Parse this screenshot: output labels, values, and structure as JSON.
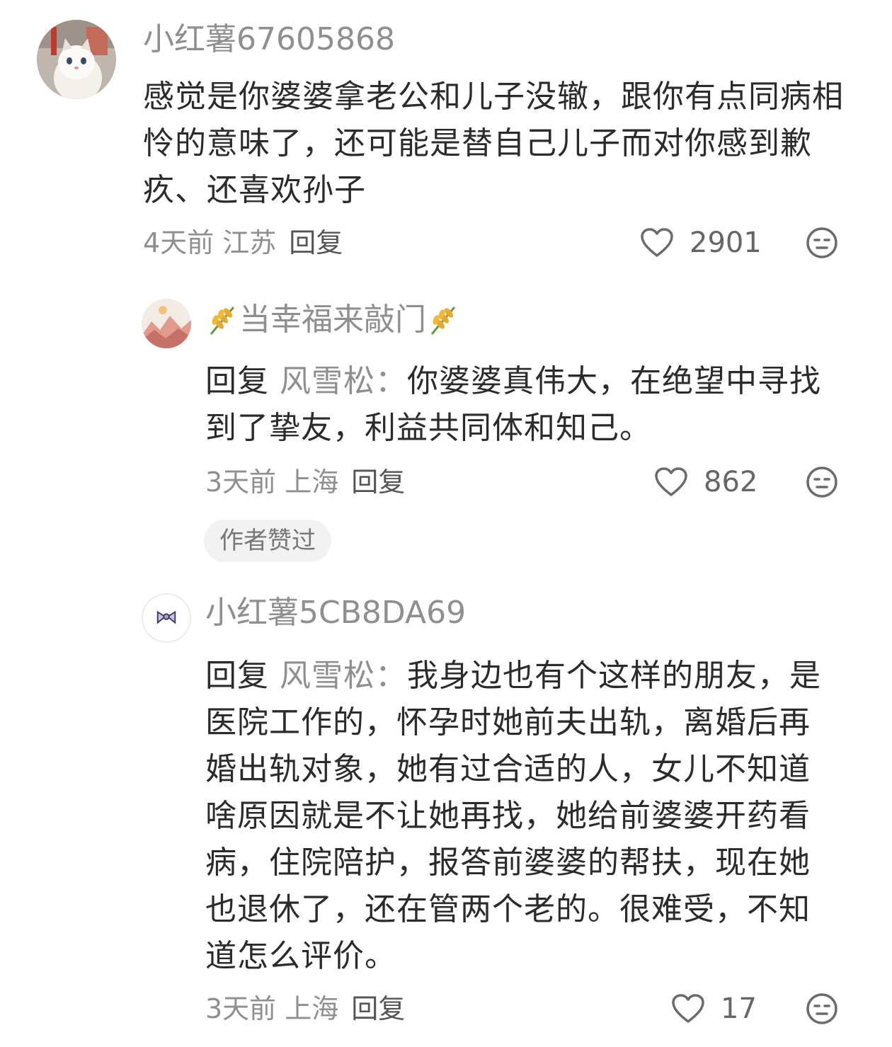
{
  "comments": [
    {
      "username": "小红薯67605868",
      "text": "感觉是你婆婆拿老公和儿子没辙，跟你有点同病相怜的意味了，还可能是替自己儿子而对你感到歉疚、还喜欢孙子",
      "time": "4天前",
      "location": "江苏",
      "reply_label": "回复",
      "likes": "2901",
      "avatar_icon": "cat-avatar-icon"
    },
    {
      "username": "当幸福来敲门",
      "reply_prefix": "回复",
      "reply_to": "风雪松：",
      "text": "你婆婆真伟大，在绝望中寻找到了挚友，利益共同体和知己。",
      "time": "3天前",
      "location": "上海",
      "reply_label": "回复",
      "likes": "862",
      "badge": "作者赞过",
      "avatar_icon": "landscape-avatar-icon"
    },
    {
      "username": "小红薯5CB8DA69",
      "reply_prefix": "回复",
      "reply_to": "风雪松：",
      "text": "我身边也有个这样的朋友，是医院工作的，怀孕时她前夫出轨，离婚后再婚出轨对象，她有过合适的人，女儿不知道啥原因就是不让她再找，她给前婆婆开药看病，住院陪护，报答前婆婆的帮扶，现在她也退休了，还在管两个老的。很难受，不知道怎么评价。",
      "time": "3天前",
      "location": "上海",
      "reply_label": "回复",
      "likes": "17",
      "avatar_icon": "bow-avatar-icon"
    }
  ],
  "colors": {
    "text_primary": "#2b2b2b",
    "text_secondary": "#8f8f8f",
    "badge_bg": "#f2f2f2"
  }
}
